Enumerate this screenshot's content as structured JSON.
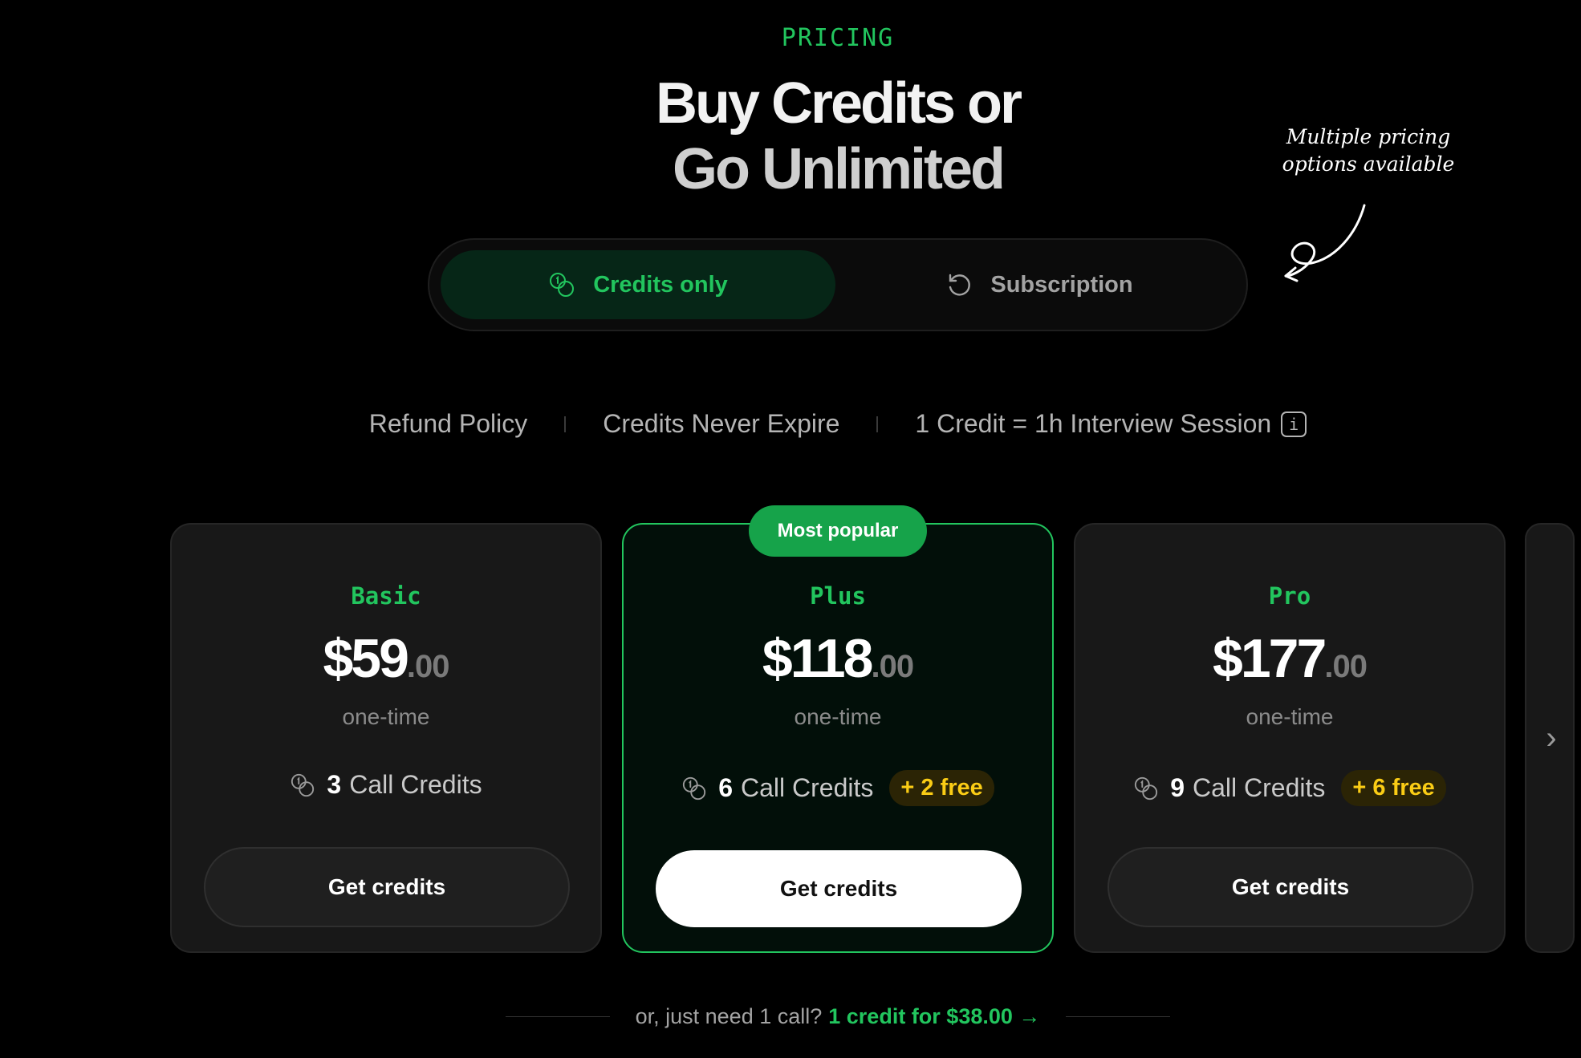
{
  "section": {
    "eyebrow": "PRICING",
    "headline_line1": "Buy Credits or",
    "headline_line2": "Go Unlimited",
    "handwritten_note": "Multiple pricing options available"
  },
  "toggle": {
    "options": [
      {
        "label": "Credits only",
        "icon": "coins-icon",
        "active": true
      },
      {
        "label": "Subscription",
        "icon": "refresh-icon",
        "active": false
      }
    ]
  },
  "features": {
    "refund": "Refund Policy",
    "never_expire": "Credits Never Expire",
    "credit_def": "1 Credit = 1h Interview Session",
    "info_glyph": "i"
  },
  "plans": [
    {
      "tier": "Basic",
      "price_whole": "$59",
      "price_cents": ".00",
      "period": "one-time",
      "credits": "3",
      "credits_label": "Call Credits",
      "bonus": "",
      "cta": "Get credits"
    },
    {
      "tier": "Plus",
      "price_whole": "$118",
      "price_cents": ".00",
      "period": "one-time",
      "credits": "6",
      "credits_label": "Call Credits",
      "bonus": "+ 2 free",
      "cta": "Get credits",
      "badge": "Most popular"
    },
    {
      "tier": "Pro",
      "price_whole": "$177",
      "price_cents": ".00",
      "period": "one-time",
      "credits": "9",
      "credits_label": "Call Credits",
      "bonus": "+ 6 free",
      "cta": "Get credits"
    }
  ],
  "single_call": {
    "prefix": "or, just need 1 call?",
    "link": "1 credit for $38.00 →"
  },
  "carousel": {
    "next_glyph": "›"
  },
  "colors": {
    "accent": "#22c55e",
    "bonus": "#facc15",
    "background": "#000000"
  }
}
